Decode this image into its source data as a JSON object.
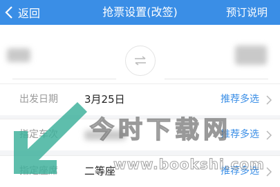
{
  "header": {
    "back_label": "返回",
    "title": "抢票设置(改签)",
    "right_action": "预订说明",
    "bg_color": "#3a8ee6"
  },
  "stations": {
    "swap_icon": "swap-arrows-icon"
  },
  "rows": [
    {
      "label": "出发日期",
      "value": "3月25日",
      "link": "推荐多选"
    },
    {
      "label": "指定车次",
      "value": "",
      "link": "推荐多选"
    },
    {
      "label": "指定座席",
      "value": "二等座",
      "link": "推荐多选"
    }
  ],
  "watermark": {
    "text": "今时下载网",
    "url": "www.bookshi.com"
  },
  "colors": {
    "accent": "#3a8ee6",
    "arrow": "#3bb09a"
  }
}
